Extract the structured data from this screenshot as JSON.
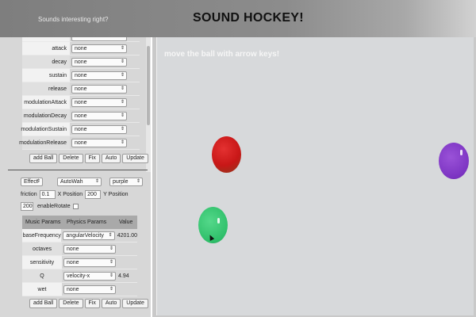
{
  "header": {
    "tagline": "Sounds interesting right?",
    "title": "SOUND HOCKEY!"
  },
  "envelope": {
    "rows": [
      {
        "label": "attack",
        "value": "none"
      },
      {
        "label": "decay",
        "value": "none"
      },
      {
        "label": "sustain",
        "value": "none"
      },
      {
        "label": "release",
        "value": "none"
      },
      {
        "label": "modulationAttack",
        "value": "none"
      },
      {
        "label": "modulationDecay",
        "value": "none"
      },
      {
        "label": "modulationSustain",
        "value": "none"
      },
      {
        "label": "modulationRelease",
        "value": "none"
      }
    ],
    "buttons": [
      "add Ball",
      "Delete",
      "Fix",
      "Auto",
      "Update"
    ]
  },
  "effect": {
    "type_select": "Effect",
    "effect_select": "AutoWah",
    "color_select": "purple",
    "friction_label": "friction",
    "friction_value": "0.1",
    "xpos_label": "X Position",
    "xpos_value": "200",
    "ypos_label": "Y Position",
    "ypos_value": "200",
    "rotate_label": "enableRotate"
  },
  "music_table": {
    "headers": [
      "Music Params",
      "Physics Params",
      "Value"
    ],
    "rows": [
      {
        "label": "baseFrequency",
        "physics": "angularVelocity",
        "value": "4201.00"
      },
      {
        "label": "octaves",
        "physics": "none",
        "value": ""
      },
      {
        "label": "sensitivity",
        "physics": "none",
        "value": ""
      },
      {
        "label": "Q",
        "physics": "velocity-x",
        "value": "4.94"
      },
      {
        "label": "wet",
        "physics": "none",
        "value": ""
      }
    ],
    "buttons": [
      "add Ball",
      "Delete",
      "Fix",
      "Auto",
      "Update"
    ]
  },
  "game": {
    "instruction": "move the ball with arrow keys!",
    "balls": [
      {
        "color": "#c81717",
        "name": "red"
      },
      {
        "color": "#7c34c2",
        "name": "purple"
      },
      {
        "color": "#2fbf6a",
        "name": "green"
      }
    ]
  },
  "icons": {
    "select_arrow": "updown-arrow-icon",
    "cursor": "mouse-cursor-icon"
  }
}
